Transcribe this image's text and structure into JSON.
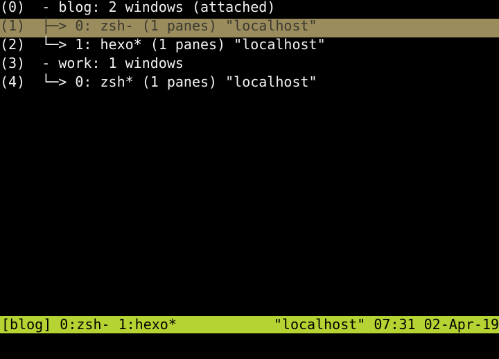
{
  "tree": {
    "rows": [
      {
        "index": "(0)",
        "branch": "- ",
        "label": "blog: 2 windows (attached)"
      },
      {
        "index": "(1)",
        "branch": "├─> ",
        "label": "0: zsh- (1 panes) \"localhost\""
      },
      {
        "index": "(2)",
        "branch": "└─> ",
        "label": "1: hexo* (1 panes) \"localhost\""
      },
      {
        "index": "(3)",
        "branch": "- ",
        "label": "work: 1 windows"
      },
      {
        "index": "(4)",
        "branch": "└─> ",
        "label": "0: zsh* (1 panes) \"localhost\""
      }
    ]
  },
  "status_bar": {
    "left": "[blog] 0:zsh- 1:hexo*",
    "right": "\"localhost\" 07:31 02-Apr-19"
  },
  "colors": {
    "background": "#000000",
    "selected_row": "#9b8c5e",
    "status_bar": "#b5d433"
  }
}
